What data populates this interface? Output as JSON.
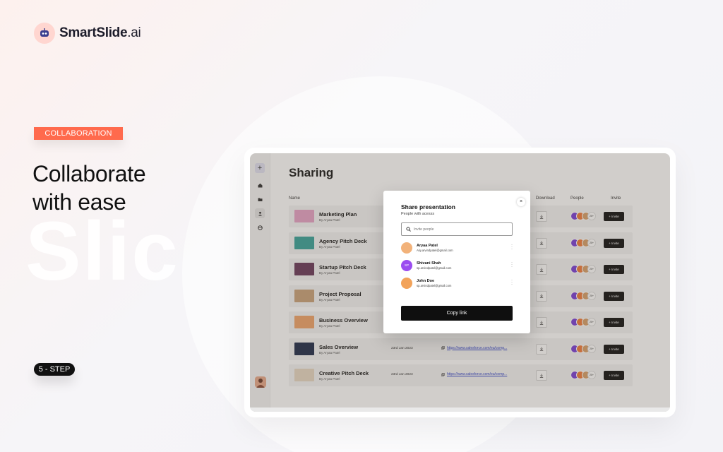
{
  "brand": {
    "name_bold": "SmartSlide",
    "name_light": ".ai"
  },
  "hero": {
    "tag": "COLLABORATION",
    "headline_line1": "Collaborate",
    "headline_line2": "with ease",
    "watermark": "Slic",
    "step": "5 - STEP"
  },
  "app": {
    "page_title": "Sharing",
    "columns": {
      "name": "Name",
      "download": "Download",
      "people": "People",
      "invite": "Invite"
    },
    "rows": [
      {
        "name": "Marketing Plan",
        "by": "By  Aryaa Patel",
        "date": "",
        "link": "",
        "thumb_color": "#e7a2c6"
      },
      {
        "name": "Agency Pitch Deck",
        "by": "By  Aryaa Patel",
        "date": "",
        "link": "",
        "thumb_color": "#3aa39a"
      },
      {
        "name": "Startup Pitch Deck",
        "by": "By  Aryaa Patel",
        "date": "",
        "link": "",
        "thumb_color": "#6a3a5a"
      },
      {
        "name": "Project Proposal",
        "by": "By  Aryaa Patel",
        "date": "",
        "link": "",
        "thumb_color": "#c9a27a"
      },
      {
        "name": "Business Overview",
        "by": "By  Aryaa Patel",
        "date": "",
        "link": "",
        "thumb_color": "#f0a46a"
      },
      {
        "name": "Sales Overview",
        "by": "By  Aryaa Patel",
        "date": "23rd Jan 2023",
        "link": "https://www.salesforce.com/eu/comp...",
        "thumb_color": "#1f2c4a"
      },
      {
        "name": "Creative Pitch Deck",
        "by": "By  Aryaa Patel",
        "date": "23rd Jan 2023",
        "link": "https://www.salesforce.com/eu/comp...",
        "thumb_color": "#e8d8c4"
      }
    ],
    "people_more": "20+",
    "invite_label": "+ Invite"
  },
  "modal": {
    "title": "Share presentation",
    "subtitle": "People with acesss",
    "search_placeholder": "Invite people",
    "members": [
      {
        "name": "Aryaa Patel",
        "email": "Aky.arvindpatel@gmail.com",
        "initials": "",
        "color": "#f2b27a"
      },
      {
        "name": "Shivani Shah",
        "email": "sp.arvindpatel@gmail.com",
        "initials": "SP",
        "color": "#9b4cf0"
      },
      {
        "name": "John Doe",
        "email": "sp.arvindpatel@gmail.com",
        "initials": "",
        "color": "#f2a35a"
      }
    ],
    "close_label": "×",
    "copy_label": "Copy link"
  },
  "sidebar": {
    "add_label": "+"
  }
}
